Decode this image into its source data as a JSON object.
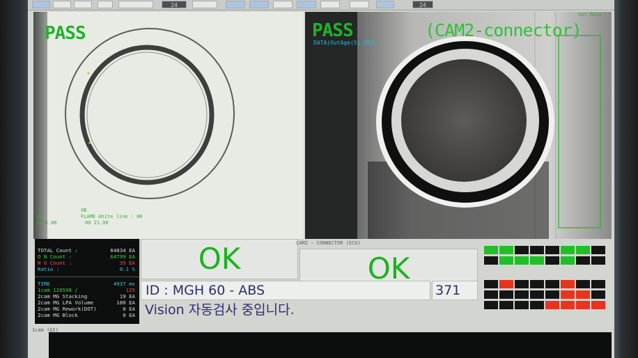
{
  "toolbar": {
    "buttons": [
      "",
      "",
      "",
      "",
      "",
      "24",
      "",
      "",
      "",
      "",
      "",
      "",
      "",
      "",
      "24"
    ]
  },
  "cam1": {
    "status": "PASS",
    "small_top": "0B",
    "small_left_1": "00",
    "small_left_2": "00 0.00",
    "small_mid_1": "FLAME Ahite line : 00",
    "small_mid_2": "00 21.00"
  },
  "cam2": {
    "status": "PASS",
    "title": "(CAM2-connector)",
    "sub": "DATA(OutAge(5),BEA)",
    "corner": "Set Move",
    "label": "CAM2 - CONNECTOR (ECU)"
  },
  "stats": {
    "rows": [
      {
        "label": "TOTAL    Count :",
        "value": "64834 EA",
        "color": "white"
      },
      {
        "label": "O    N   Count :",
        "value": "64799 EA",
        "color": "green"
      },
      {
        "label": "N    G   Count :",
        "value": "35 EA",
        "color": "red"
      },
      {
        "label": "Ratio          :",
        "value": "0.1  %",
        "color": "cyan"
      },
      {
        "label": "TIME",
        "value": "4937 ms",
        "color": "cyan"
      },
      {
        "label": "1cam   129598 /",
        "value": "125",
        "color": "mixed"
      },
      {
        "label": "2cam MG Stacking",
        "value": "19 EA",
        "color": "white"
      },
      {
        "label": "2cam MG LPA Volume",
        "value": "180 EA",
        "color": "white"
      },
      {
        "label": "2cam MG Rework(DOT)",
        "value": "0 EA",
        "color": "white"
      },
      {
        "label": "2cam MG Block",
        "value": "0 EA",
        "color": "white"
      }
    ]
  },
  "result": {
    "ok1": "OK",
    "ok2": "OK",
    "id_text": "ID : MGH 60  - ABS",
    "count": "371",
    "message": "Vision 자동검사 중입니다."
  },
  "log": {
    "label": "1cam\n(GI)"
  },
  "colors": {
    "ok_green": "#1bb31f",
    "pass_green": "#21b22b",
    "cell_green": "#1fbf2a",
    "cell_red": "#e8341c",
    "cell_black": "#151515"
  },
  "grid_top": [
    [
      "g",
      "g",
      "k",
      "k",
      "k",
      "g",
      "g",
      "k"
    ],
    [
      "k",
      "g",
      "g",
      "g",
      "k",
      "g",
      "k",
      "k"
    ]
  ],
  "grid_bottom": [
    [
      "k",
      "r",
      "k",
      "k",
      "k",
      "r",
      "k",
      "k"
    ],
    [
      "k",
      "k",
      "k",
      "k",
      "k",
      "r",
      "r",
      "k"
    ],
    [
      "k",
      "k",
      "k",
      "k",
      "r",
      "r",
      "r",
      "r"
    ]
  ]
}
